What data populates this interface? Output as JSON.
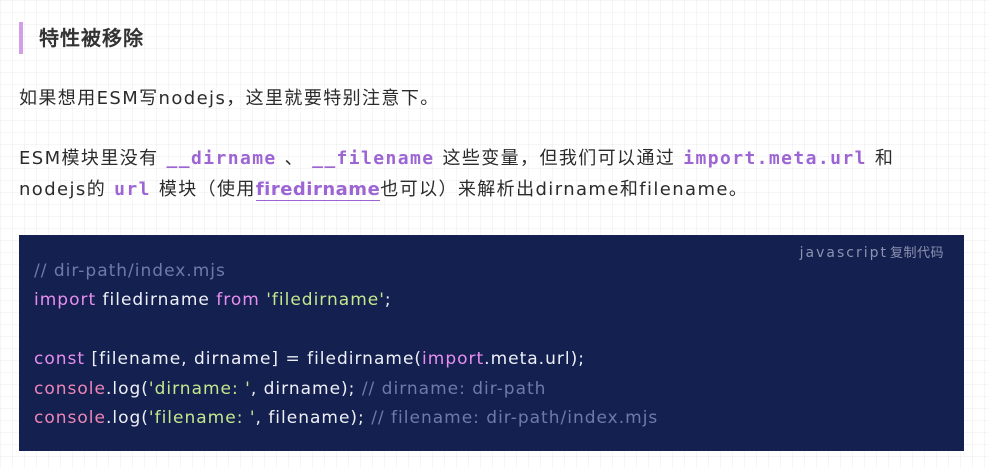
{
  "heading": "特性被移除",
  "intro": "如果想用ESM写nodejs，这里就要特别注意下。",
  "para": {
    "t1": "ESM模块里没有",
    "code1": "__dirname",
    "sep": "、",
    "code2": "__filename",
    "t2": "这些变量，但我们可以通过",
    "code3": "import.meta.url",
    "t3": "和",
    "t4": "nodejs的",
    "code4": "url",
    "t5": "模块（使用",
    "link": "firedirname",
    "t6": "也可以）来解析出dirname和filename。"
  },
  "code": {
    "lang": "javascript",
    "copy_label": "复制代码",
    "l1_comment": "// dir-path/index.mjs",
    "l2_kw1": "import",
    "l2_id": " filedirname ",
    "l2_kw2": "from",
    "l2_str": "'filedirname'",
    "l2_end": ";",
    "l4_kw": "const",
    "l4_a": " [filename, dirname] = filedirname(",
    "l4_kw2": "import",
    "l4_b": ".meta.url);",
    "l5_fn": "console",
    "l5_a": ".log(",
    "l5_str": "'dirname: '",
    "l5_b": ", dirname); ",
    "l5_comment": "// dirname: dir-path",
    "l6_fn": "console",
    "l6_a": ".log(",
    "l6_str": "'filename: '",
    "l6_b": ", filename); ",
    "l6_comment": "// filename: dir-path/index.mjs"
  }
}
